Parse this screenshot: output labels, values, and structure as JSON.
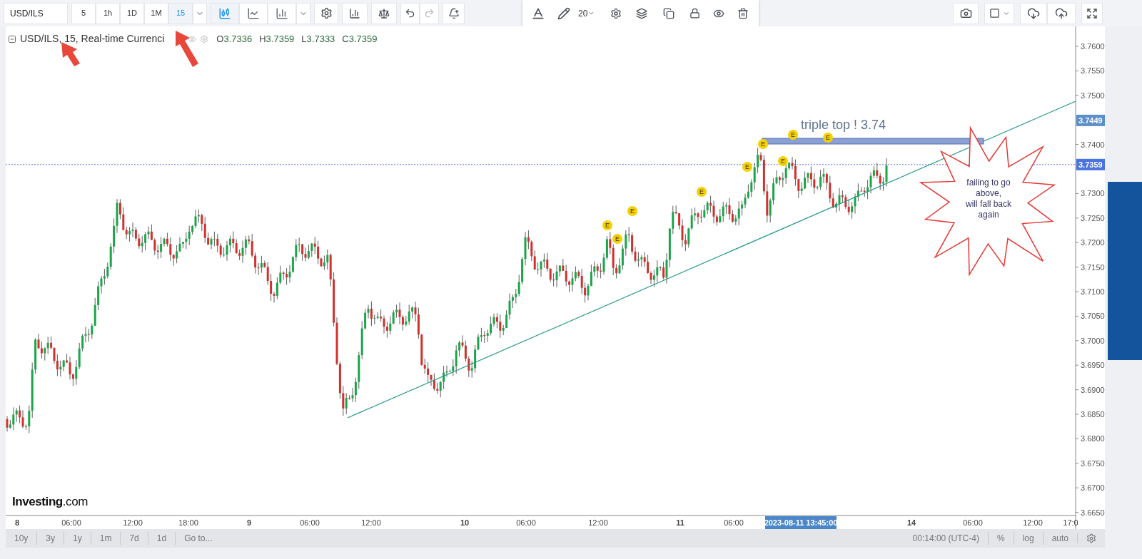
{
  "toolbar": {
    "symbol": "USD/ILS",
    "intervals": [
      {
        "label": "5",
        "selected": false
      },
      {
        "label": "1h",
        "selected": false
      },
      {
        "label": "1D",
        "selected": false
      },
      {
        "label": "1M",
        "selected": false
      },
      {
        "label": "15",
        "selected": true
      }
    ],
    "chart_types": [
      {
        "kind": "candles",
        "selected": true
      },
      {
        "kind": "line",
        "selected": false
      },
      {
        "kind": "bars",
        "selected": false
      }
    ]
  },
  "drawing_toolbar": {
    "font_size": "20"
  },
  "legend": {
    "title": "USD/ILS, 15, Real-time Currenci",
    "values": [
      {
        "label": "O",
        "value": "3.7336"
      },
      {
        "label": "H",
        "value": "3.7359"
      },
      {
        "label": "L",
        "value": "3.7333"
      },
      {
        "label": "C",
        "value": "3.7359"
      }
    ]
  },
  "chart": {
    "y_ticks": [
      "3.7600",
      "3.7550",
      "3.7500",
      "3.7400",
      "3.7300",
      "3.7250",
      "3.7200",
      "3.7150",
      "3.7100",
      "3.7050",
      "3.7000",
      "3.6950",
      "3.6900",
      "3.6850",
      "3.6800",
      "3.6750",
      "3.6700",
      "3.6650"
    ],
    "price_labels": [
      {
        "text": "3.7449",
        "color": "#5b8fc9"
      },
      {
        "text": "3.7359",
        "color": "#4a72e0"
      }
    ],
    "x_labels": [
      {
        "text": "8",
        "kind": "day"
      },
      {
        "text": "06:00",
        "kind": "time"
      },
      {
        "text": "12:00",
        "kind": "time"
      },
      {
        "text": "18:00",
        "kind": "time"
      },
      {
        "text": "9",
        "kind": "day"
      },
      {
        "text": "06:00",
        "kind": "time"
      },
      {
        "text": "12:00",
        "kind": "time"
      },
      {
        "text": "10",
        "kind": "day"
      },
      {
        "text": "06:00",
        "kind": "time"
      },
      {
        "text": "12:00",
        "kind": "time"
      },
      {
        "text": "11",
        "kind": "day"
      },
      {
        "text": "06:00",
        "kind": "time"
      },
      {
        "text": "14",
        "kind": "day"
      },
      {
        "text": "06:00",
        "kind": "time"
      },
      {
        "text": "12:00",
        "kind": "time"
      },
      {
        "text": "17:0",
        "kind": "time"
      }
    ],
    "crosshair_time": "2023-08-11 13:45:00",
    "event_markers": [
      "E",
      "E",
      "E",
      "E",
      "E",
      "E",
      "E",
      "E",
      "E"
    ],
    "annotation_text": "triple top ! 3.74",
    "callout_text": "failing to go\nabove,\nwill fall back\nagain",
    "logo": "**Investing**.com"
  },
  "bottom_bar": {
    "ranges": [
      "10y",
      "3y",
      "1y",
      "1m",
      "7d",
      "1d",
      "Go to..."
    ],
    "timezone": "00:14:00 (UTC-4)",
    "options": [
      "%",
      "log",
      "auto"
    ]
  }
}
